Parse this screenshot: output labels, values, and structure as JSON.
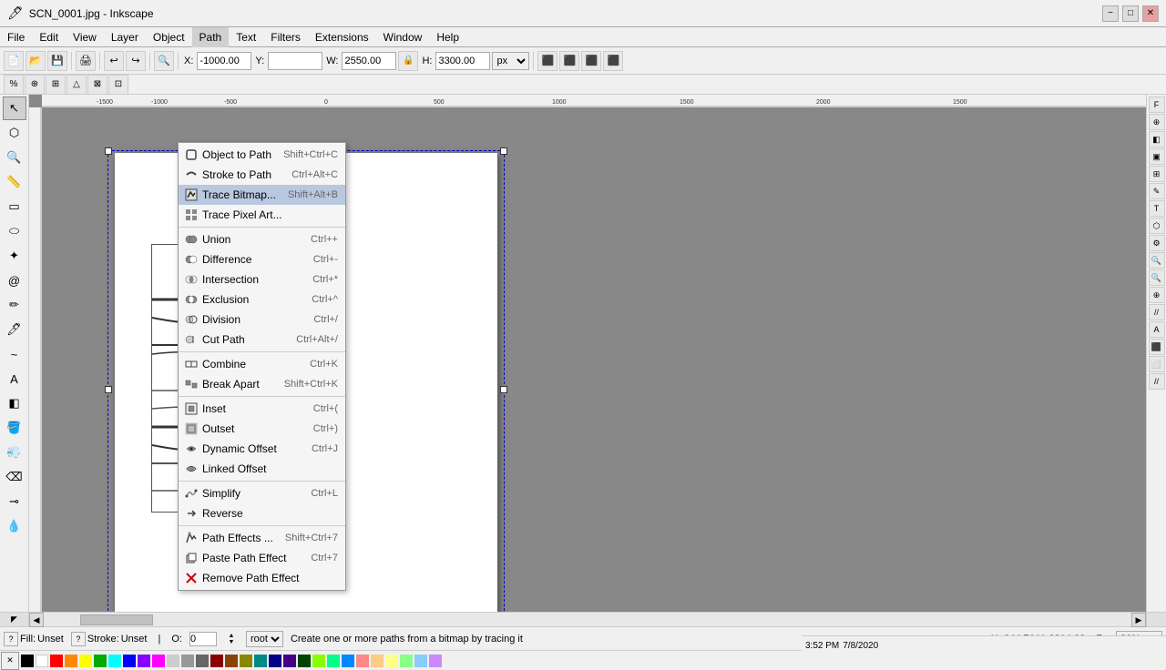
{
  "window": {
    "title": "SCN_0001.jpg - Inkscape"
  },
  "titlebar": {
    "title": "SCN_0001.jpg - Inkscape",
    "min": "−",
    "max": "□",
    "close": "✕"
  },
  "menubar": {
    "items": [
      "File",
      "Edit",
      "View",
      "Layer",
      "Object",
      "Path",
      "Text",
      "Filters",
      "Extensions",
      "Window",
      "Help"
    ]
  },
  "toolbar": {
    "x_label": "X:",
    "x_value": "-1000.00",
    "y_label": "Y:",
    "y_value": "",
    "w_label": "W:",
    "w_value": "2550.00",
    "h_label": "H:",
    "h_value": "3300.00",
    "unit": "px",
    "lock": "🔒"
  },
  "path_menu": {
    "items": [
      {
        "id": "object-to-path",
        "label": "Object to Path",
        "shortcut": "Shift+Ctrl+C",
        "icon": "path-icon",
        "divider_after": false
      },
      {
        "id": "stroke-to-path",
        "label": "Stroke to Path",
        "shortcut": "Ctrl+Alt+C",
        "icon": "stroke-icon",
        "divider_after": false
      },
      {
        "id": "trace-bitmap",
        "label": "Trace Bitmap...",
        "shortcut": "Shift+Alt+B",
        "icon": "trace-icon",
        "highlighted": true,
        "divider_after": false
      },
      {
        "id": "trace-pixel-art",
        "label": "Trace Pixel Art...",
        "shortcut": "",
        "icon": "pixel-icon",
        "divider_after": true
      },
      {
        "id": "union",
        "label": "Union",
        "shortcut": "Ctrl++",
        "icon": "union-icon",
        "divider_after": false
      },
      {
        "id": "difference",
        "label": "Difference",
        "shortcut": "Ctrl+-",
        "icon": "diff-icon",
        "divider_after": false
      },
      {
        "id": "intersection",
        "label": "Intersection",
        "shortcut": "Ctrl+*",
        "icon": "intersect-icon",
        "divider_after": false
      },
      {
        "id": "exclusion",
        "label": "Exclusion",
        "shortcut": "Ctrl+^",
        "icon": "excl-icon",
        "divider_after": false
      },
      {
        "id": "division",
        "label": "Division",
        "shortcut": "Ctrl+/",
        "icon": "div-icon",
        "divider_after": false
      },
      {
        "id": "cut-path",
        "label": "Cut Path",
        "shortcut": "Ctrl+Alt+/",
        "icon": "cut-icon",
        "divider_after": true
      },
      {
        "id": "combine",
        "label": "Combine",
        "shortcut": "Ctrl+K",
        "icon": "combine-icon",
        "divider_after": false
      },
      {
        "id": "break-apart",
        "label": "Break Apart",
        "shortcut": "Shift+Ctrl+K",
        "icon": "break-icon",
        "divider_after": true
      },
      {
        "id": "inset",
        "label": "Inset",
        "shortcut": "Ctrl+(",
        "icon": "inset-icon",
        "divider_after": false
      },
      {
        "id": "outset",
        "label": "Outset",
        "shortcut": "Ctrl+)",
        "icon": "outset-icon",
        "divider_after": false
      },
      {
        "id": "dynamic-offset",
        "label": "Dynamic Offset",
        "shortcut": "Ctrl+J",
        "icon": "dynoff-icon",
        "divider_after": false
      },
      {
        "id": "linked-offset",
        "label": "Linked Offset",
        "shortcut": "",
        "icon": "linkoff-icon",
        "divider_after": true
      },
      {
        "id": "simplify",
        "label": "Simplify",
        "shortcut": "Ctrl+L",
        "icon": "simplify-icon",
        "divider_after": false
      },
      {
        "id": "reverse",
        "label": "Reverse",
        "shortcut": "",
        "icon": "reverse-icon",
        "divider_after": true
      },
      {
        "id": "path-effects",
        "label": "Path Effects ...",
        "shortcut": "Shift+Ctrl+7",
        "icon": "fx-icon",
        "divider_after": false
      },
      {
        "id": "paste-path-effect",
        "label": "Paste Path Effect",
        "shortcut": "Ctrl+7",
        "icon": "paste-fx-icon",
        "divider_after": false
      },
      {
        "id": "remove-path-effect",
        "label": "Remove Path Effect",
        "shortcut": "",
        "icon": "remove-fx-icon",
        "divider_after": false
      }
    ]
  },
  "statusbar": {
    "fill_label": "Fill:",
    "fill_value": "Unset",
    "stroke_label": "Stroke:",
    "stroke_value": "Unset",
    "opacity_label": "O:",
    "opacity_value": "0",
    "transform_label": "",
    "xy_label": "root",
    "status_text": "Create one or more paths from a bitmap by tracing it",
    "xy_coords": "X:-344.76  Y: 3314.82",
    "zoom": "20%",
    "datetime": "3:52 PM\n7/8/2020"
  },
  "colors": {
    "accent_blue": "#4a7bb5",
    "menu_highlight": "#b8c8e0",
    "bg": "#888888",
    "canvas_bg": "#ffffff"
  }
}
